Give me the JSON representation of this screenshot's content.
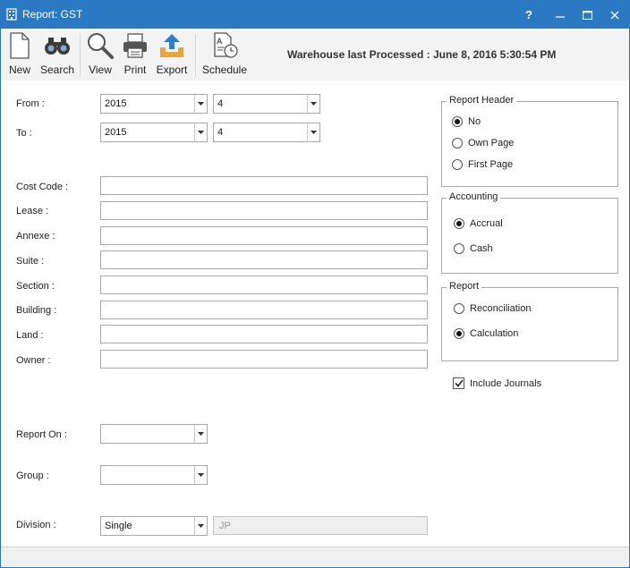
{
  "window": {
    "title": "Report: GST",
    "help_label": "?",
    "minimize_label": "—",
    "maximize_label": "☐",
    "close_label": "✕"
  },
  "toolbar": {
    "items": [
      {
        "label": "New",
        "icon": "new-document-icon"
      },
      {
        "label": "Search",
        "icon": "binoculars-icon"
      },
      {
        "label": "View",
        "icon": "magnifier-icon"
      },
      {
        "label": "Print",
        "icon": "printer-icon"
      },
      {
        "label": "Export",
        "icon": "export-tray-icon"
      },
      {
        "label": "Schedule",
        "icon": "schedule-icon"
      }
    ],
    "warehouse_text": "Warehouse last Processed : June 8, 2016 5:30:54 PM"
  },
  "period": {
    "from_label": "From :",
    "to_label": "To :",
    "from_year": "2015",
    "from_period": "4",
    "to_year": "2015",
    "to_period": "4"
  },
  "filters": [
    {
      "label": "Cost Code :",
      "value": ""
    },
    {
      "label": "Lease :",
      "value": ""
    },
    {
      "label": "Annexe :",
      "value": ""
    },
    {
      "label": "Suite :",
      "value": ""
    },
    {
      "label": "Section :",
      "value": ""
    },
    {
      "label": "Building :",
      "value": ""
    },
    {
      "label": "Land :",
      "value": ""
    },
    {
      "label": "Owner :",
      "value": ""
    }
  ],
  "report_on": {
    "label": "Report On :",
    "value": ""
  },
  "group": {
    "label": "Group :",
    "value": ""
  },
  "division": {
    "label": "Division :",
    "value": "Single",
    "code": "JP"
  },
  "report_header": {
    "legend": "Report Header",
    "options": [
      {
        "label": "No",
        "selected": true
      },
      {
        "label": "Own Page",
        "selected": false
      },
      {
        "label": "First Page",
        "selected": false
      }
    ]
  },
  "accounting": {
    "legend": "Accounting",
    "options": [
      {
        "label": "Accrual",
        "selected": true
      },
      {
        "label": "Cash",
        "selected": false
      }
    ]
  },
  "report": {
    "legend": "Report",
    "options": [
      {
        "label": "Reconciliation",
        "selected": false
      },
      {
        "label": "Calculation",
        "selected": true
      }
    ]
  },
  "include_journals": {
    "label": "Include Journals",
    "checked": true
  },
  "colors": {
    "titlebar": "#2b79c2",
    "toolbar": "#f3f3f3",
    "export_arrow": "#2f7fd0",
    "export_tray": "#e7a53a"
  }
}
